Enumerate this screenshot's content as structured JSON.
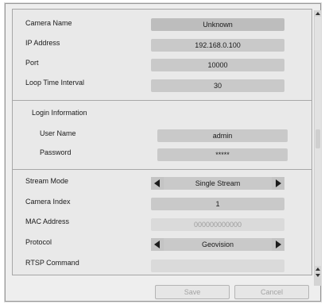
{
  "fields": {
    "camera_name": {
      "label": "Camera Name",
      "value": "Unknown"
    },
    "ip_address": {
      "label": "IP Address",
      "value": "192.168.0.100"
    },
    "port": {
      "label": "Port",
      "value": "10000"
    },
    "loop_time": {
      "label": "Loop Time Interval",
      "value": "30"
    }
  },
  "login": {
    "title": "Login Information",
    "user_name": {
      "label": "User Name",
      "value": "admin"
    },
    "password": {
      "label": "Password",
      "value": "*****"
    }
  },
  "stream": {
    "stream_mode": {
      "label": "Stream Mode",
      "value": "Single Stream"
    },
    "camera_index": {
      "label": "Camera Index",
      "value": "1"
    },
    "mac_address": {
      "label": "MAC Address",
      "value": "000000000000"
    },
    "protocol": {
      "label": "Protocol",
      "value": "Geovision"
    },
    "rtsp_command": {
      "label": "RTSP Command",
      "value": ""
    }
  },
  "buttons": {
    "save": "Save",
    "cancel": "Cancel"
  },
  "icons": {
    "prev": "left-triangle-icon",
    "next": "right-triangle-icon",
    "scroll_up": "scroll-up-arrow-icon",
    "scroll_down": "scroll-down-arrow-icon"
  },
  "colors": {
    "field_bg": "#c9c9c9",
    "disabled_text": "#9c9c9c",
    "panel_bg": "#e9e9e9"
  }
}
